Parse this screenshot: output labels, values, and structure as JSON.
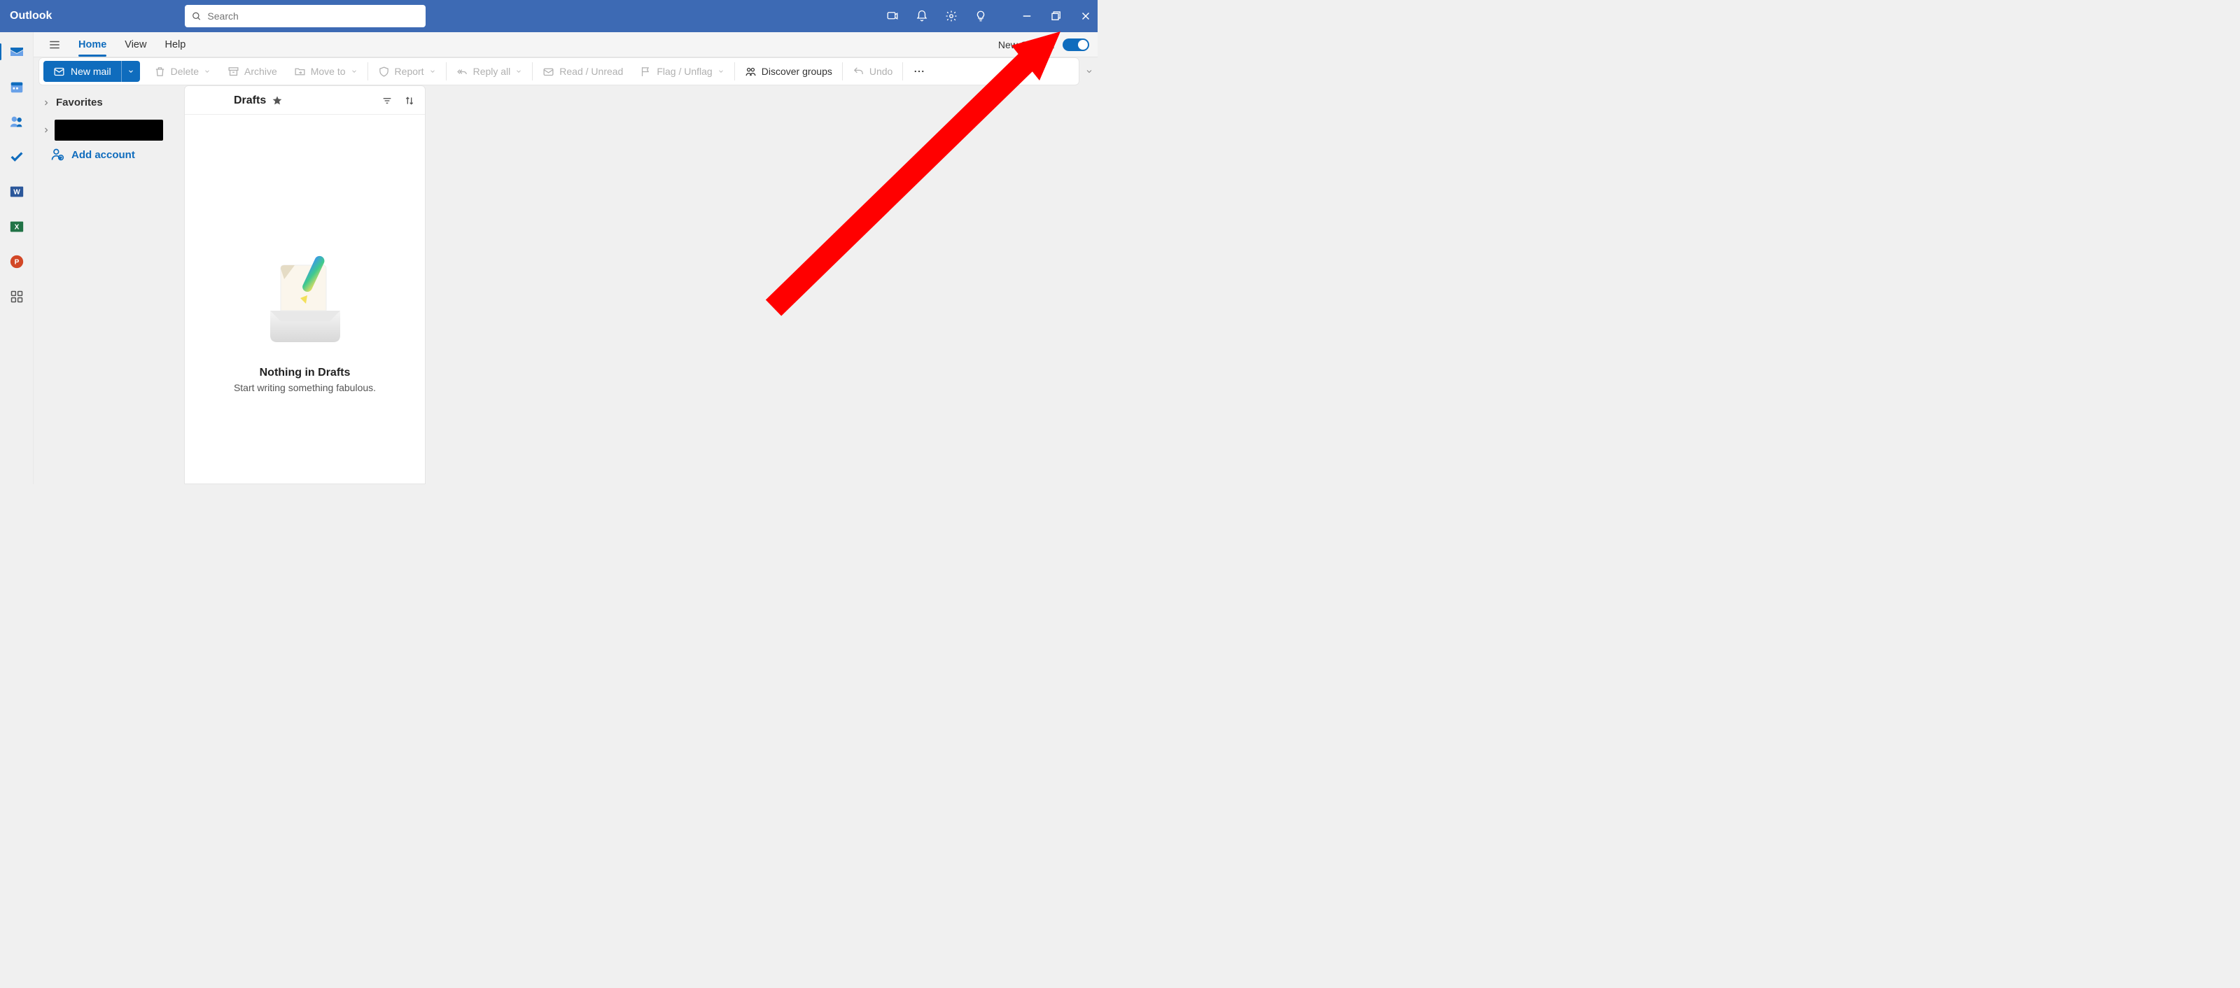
{
  "title": "Outlook",
  "search": {
    "placeholder": "Search"
  },
  "tabs": [
    "Home",
    "View",
    "Help"
  ],
  "activeTab": 0,
  "newOutlook": {
    "label": "New Outlook",
    "on": true
  },
  "ribbon": {
    "newMail": "New mail",
    "delete": "Delete",
    "archive": "Archive",
    "moveTo": "Move to",
    "report": "Report",
    "replyAll": "Reply all",
    "readUnread": "Read / Unread",
    "flag": "Flag / Unflag",
    "discover": "Discover groups",
    "undo": "Undo"
  },
  "folders": {
    "favorites": "Favorites",
    "addAccount": "Add account"
  },
  "messageList": {
    "title": "Drafts",
    "emptyTitle": "Nothing in Drafts",
    "emptySubtitle": "Start writing something fabulous."
  }
}
